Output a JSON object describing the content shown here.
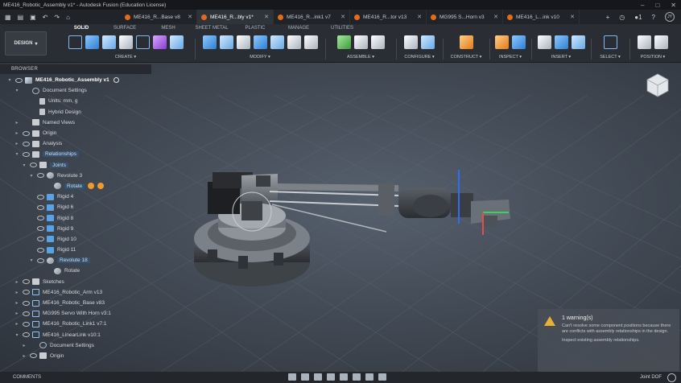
{
  "window": {
    "title": "ME416_Robotic_Assembly v1* - Autodesk Fusion (Education License)"
  },
  "tabs": [
    {
      "label": "ME416_R...Base v8",
      "active": false
    },
    {
      "label": "ME416_R...bly v1*",
      "active": true
    },
    {
      "label": "ME416_R...ink1 v7",
      "active": false
    },
    {
      "label": "ME416_R...tor v13",
      "active": false
    },
    {
      "label": "MG995 S...Horn v3",
      "active": false
    },
    {
      "label": "ME416_L...ink v10",
      "active": false
    }
  ],
  "tabbar_right": {
    "notification_count": "1",
    "user_initials": "JY"
  },
  "workspace": {
    "label": "DESIGN"
  },
  "ribbon_tabs": [
    {
      "label": "SOLID",
      "active": true
    },
    {
      "label": "SURFACE",
      "active": false
    },
    {
      "label": "MESH",
      "active": false
    },
    {
      "label": "SHEET METAL",
      "active": false
    },
    {
      "label": "PLASTIC",
      "active": false
    },
    {
      "label": "MANAGE",
      "active": false
    },
    {
      "label": "UTILITIES",
      "active": false
    }
  ],
  "ribbon_groups": [
    {
      "label": "CREATE ▾",
      "icons": [
        "sketch-icon",
        "extrude-icon",
        "revolve-icon",
        "hole-icon",
        "pattern-icon",
        "form-icon",
        "bend-icon"
      ]
    },
    {
      "label": "MODIFY ▾",
      "icons": [
        "press-pull-icon",
        "fillet-icon",
        "shell-icon",
        "combine-icon",
        "split-icon",
        "move-icon",
        "align-icon"
      ]
    },
    {
      "label": "ASSEMBLE ▾",
      "icons": [
        "new-component-icon",
        "joint-icon",
        "motion-link-icon"
      ]
    },
    {
      "label": "CONFIGURE ▾",
      "icons": [
        "configure-table-icon",
        "configure-rule-icon"
      ]
    },
    {
      "label": "CONSTRUCT ▾",
      "icons": [
        "offset-plane-icon"
      ]
    },
    {
      "label": "INSPECT ▾",
      "icons": [
        "measure-icon",
        "section-icon"
      ]
    },
    {
      "label": "INSERT ▾",
      "icons": [
        "insert-derive-icon",
        "decal-icon",
        "canvas-icon"
      ]
    },
    {
      "label": "SELECT ▾",
      "icons": [
        "select-icon"
      ]
    },
    {
      "label": "POSITION ▾",
      "icons": [
        "capture-position-icon",
        "revert-position-icon"
      ]
    }
  ],
  "browser": {
    "header": "BROWSER",
    "nodes": [
      {
        "label": "ME416_Robotic_Assembly v1",
        "indent": 0,
        "arrow": "▾",
        "icon": "comp",
        "eye": true,
        "bold": true
      },
      {
        "label": "Document Settings",
        "indent": 1,
        "arrow": "▾",
        "icon": "gear",
        "eye": false
      },
      {
        "label": "Units: mm, g",
        "indent": 2,
        "arrow": "",
        "icon": "doc",
        "eye": false
      },
      {
        "label": "Hybrid Design",
        "indent": 2,
        "arrow": "",
        "icon": "doc",
        "eye": false
      },
      {
        "label": "Named Views",
        "indent": 1,
        "arrow": "▸",
        "icon": "folder",
        "eye": false
      },
      {
        "label": "Origin",
        "indent": 1,
        "arrow": "▸",
        "icon": "folder",
        "eye": true
      },
      {
        "label": "Analysis",
        "indent": 1,
        "arrow": "▸",
        "icon": "folder",
        "eye": true
      },
      {
        "label": "Relationships",
        "indent": 1,
        "arrow": "▾",
        "icon": "folder",
        "eye": true,
        "highlight": true
      },
      {
        "label": "Joints",
        "indent": 2,
        "arrow": "▾",
        "icon": "folder",
        "eye": true,
        "highlight": true
      },
      {
        "label": "Revolute 3",
        "indent": 3,
        "arrow": "▾",
        "icon": "rev",
        "eye": true
      },
      {
        "label": "Rotate",
        "indent": 4,
        "arrow": "",
        "icon": "rev",
        "eye": false,
        "highlight": true,
        "badges": 2
      },
      {
        "label": "Rigid 4",
        "indent": 3,
        "arrow": "",
        "icon": "joint",
        "eye": true
      },
      {
        "label": "Rigid 6",
        "indent": 3,
        "arrow": "",
        "icon": "joint",
        "eye": true
      },
      {
        "label": "Rigid 8",
        "indent": 3,
        "arrow": "",
        "icon": "joint",
        "eye": true
      },
      {
        "label": "Rigid 9",
        "indent": 3,
        "arrow": "",
        "icon": "joint",
        "eye": true
      },
      {
        "label": "Rigid 10",
        "indent": 3,
        "arrow": "",
        "icon": "joint",
        "eye": true
      },
      {
        "label": "Rigid 11",
        "indent": 3,
        "arrow": "",
        "icon": "joint",
        "eye": true
      },
      {
        "label": "Revolute 18",
        "indent": 3,
        "arrow": "▾",
        "icon": "rev",
        "eye": true,
        "highlight": true
      },
      {
        "label": "Rotate",
        "indent": 4,
        "arrow": "",
        "icon": "rev",
        "eye": false
      },
      {
        "label": "Sketches",
        "indent": 1,
        "arrow": "▸",
        "icon": "folder",
        "eye": true
      },
      {
        "label": "ME416_Robotic_Arm v13",
        "indent": 1,
        "arrow": "▸",
        "icon": "link",
        "eye": true
      },
      {
        "label": "ME416_Robotic_Base v83",
        "indent": 1,
        "arrow": "▸",
        "icon": "link",
        "eye": true
      },
      {
        "label": "MG995 Servo With Horn v3:1",
        "indent": 1,
        "arrow": "▸",
        "icon": "link",
        "eye": true
      },
      {
        "label": "ME416_Robotic_Link1 v7:1",
        "indent": 1,
        "arrow": "▸",
        "icon": "link",
        "eye": true
      },
      {
        "label": "ME416_LinearLink v10:1",
        "indent": 1,
        "arrow": "▾",
        "icon": "link",
        "eye": true
      },
      {
        "label": "Document Settings",
        "indent": 2,
        "arrow": "▸",
        "icon": "gear",
        "eye": false
      },
      {
        "label": "Origin",
        "indent": 2,
        "arrow": "▸",
        "icon": "folder",
        "eye": true
      }
    ]
  },
  "warning": {
    "title": "1 warning(s)",
    "body": "Can't resolve some component positions because there are conflicts with assembly relationships in the design.",
    "link": "Inspect existing assembly relationships."
  },
  "bottom": {
    "comments_label": "COMMENTS",
    "joint_dof_label": "Joint DOF"
  },
  "colors": {
    "viewport_center": "#56606d",
    "accent_blue": "#2d7fd1",
    "warning": "#e7b233",
    "highlight_row": "#35516f"
  }
}
